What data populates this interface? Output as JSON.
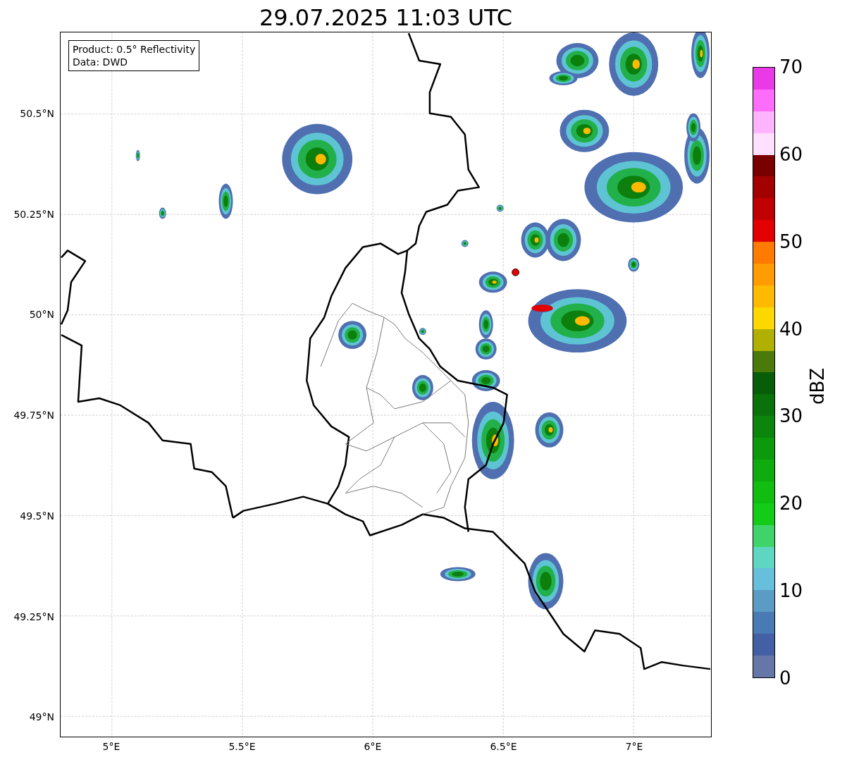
{
  "title": "29.07.2025 11:03 UTC",
  "info_box": {
    "lines": [
      "Product: 0.5° Reflectivity",
      "Data: DWD"
    ]
  },
  "map": {
    "x_ticks": [
      "5°E",
      "5.5°E",
      "6°E",
      "6.5°E",
      "7°E"
    ],
    "y_ticks": [
      "50.5°N",
      "50.25°N",
      "50°N",
      "49.75°N",
      "49.5°N",
      "49.25°N",
      "49°N"
    ]
  },
  "colorbar": {
    "label": "dBZ",
    "ticks": [
      "70",
      "60",
      "50",
      "40",
      "30",
      "20",
      "10",
      "0"
    ],
    "segments": [
      {
        "color": "#ea3ae8"
      },
      {
        "color": "#fd6cfb"
      },
      {
        "color": "#ffb4fd"
      },
      {
        "color": "#ffe0ff"
      },
      {
        "color": "#7a0000"
      },
      {
        "color": "#a30000"
      },
      {
        "color": "#c00000"
      },
      {
        "color": "#e30000"
      },
      {
        "color": "#ff7b00"
      },
      {
        "color": "#ff9c00"
      },
      {
        "color": "#ffba00"
      },
      {
        "color": "#ffd800"
      },
      {
        "color": "#b0b000"
      },
      {
        "color": "#4a7a0a"
      },
      {
        "color": "#085d08"
      },
      {
        "color": "#0a720a"
      },
      {
        "color": "#0c850c"
      },
      {
        "color": "#0c990c"
      },
      {
        "color": "#0eac0e"
      },
      {
        "color": "#10bd10"
      },
      {
        "color": "#12cc18"
      },
      {
        "color": "#3ed46a"
      },
      {
        "color": "#5ed6c2"
      },
      {
        "color": "#66c0dc"
      },
      {
        "color": "#5a9cc4"
      },
      {
        "color": "#4a7ab4"
      },
      {
        "color": "#4460a4"
      },
      {
        "color": "#6676a8"
      }
    ]
  }
}
